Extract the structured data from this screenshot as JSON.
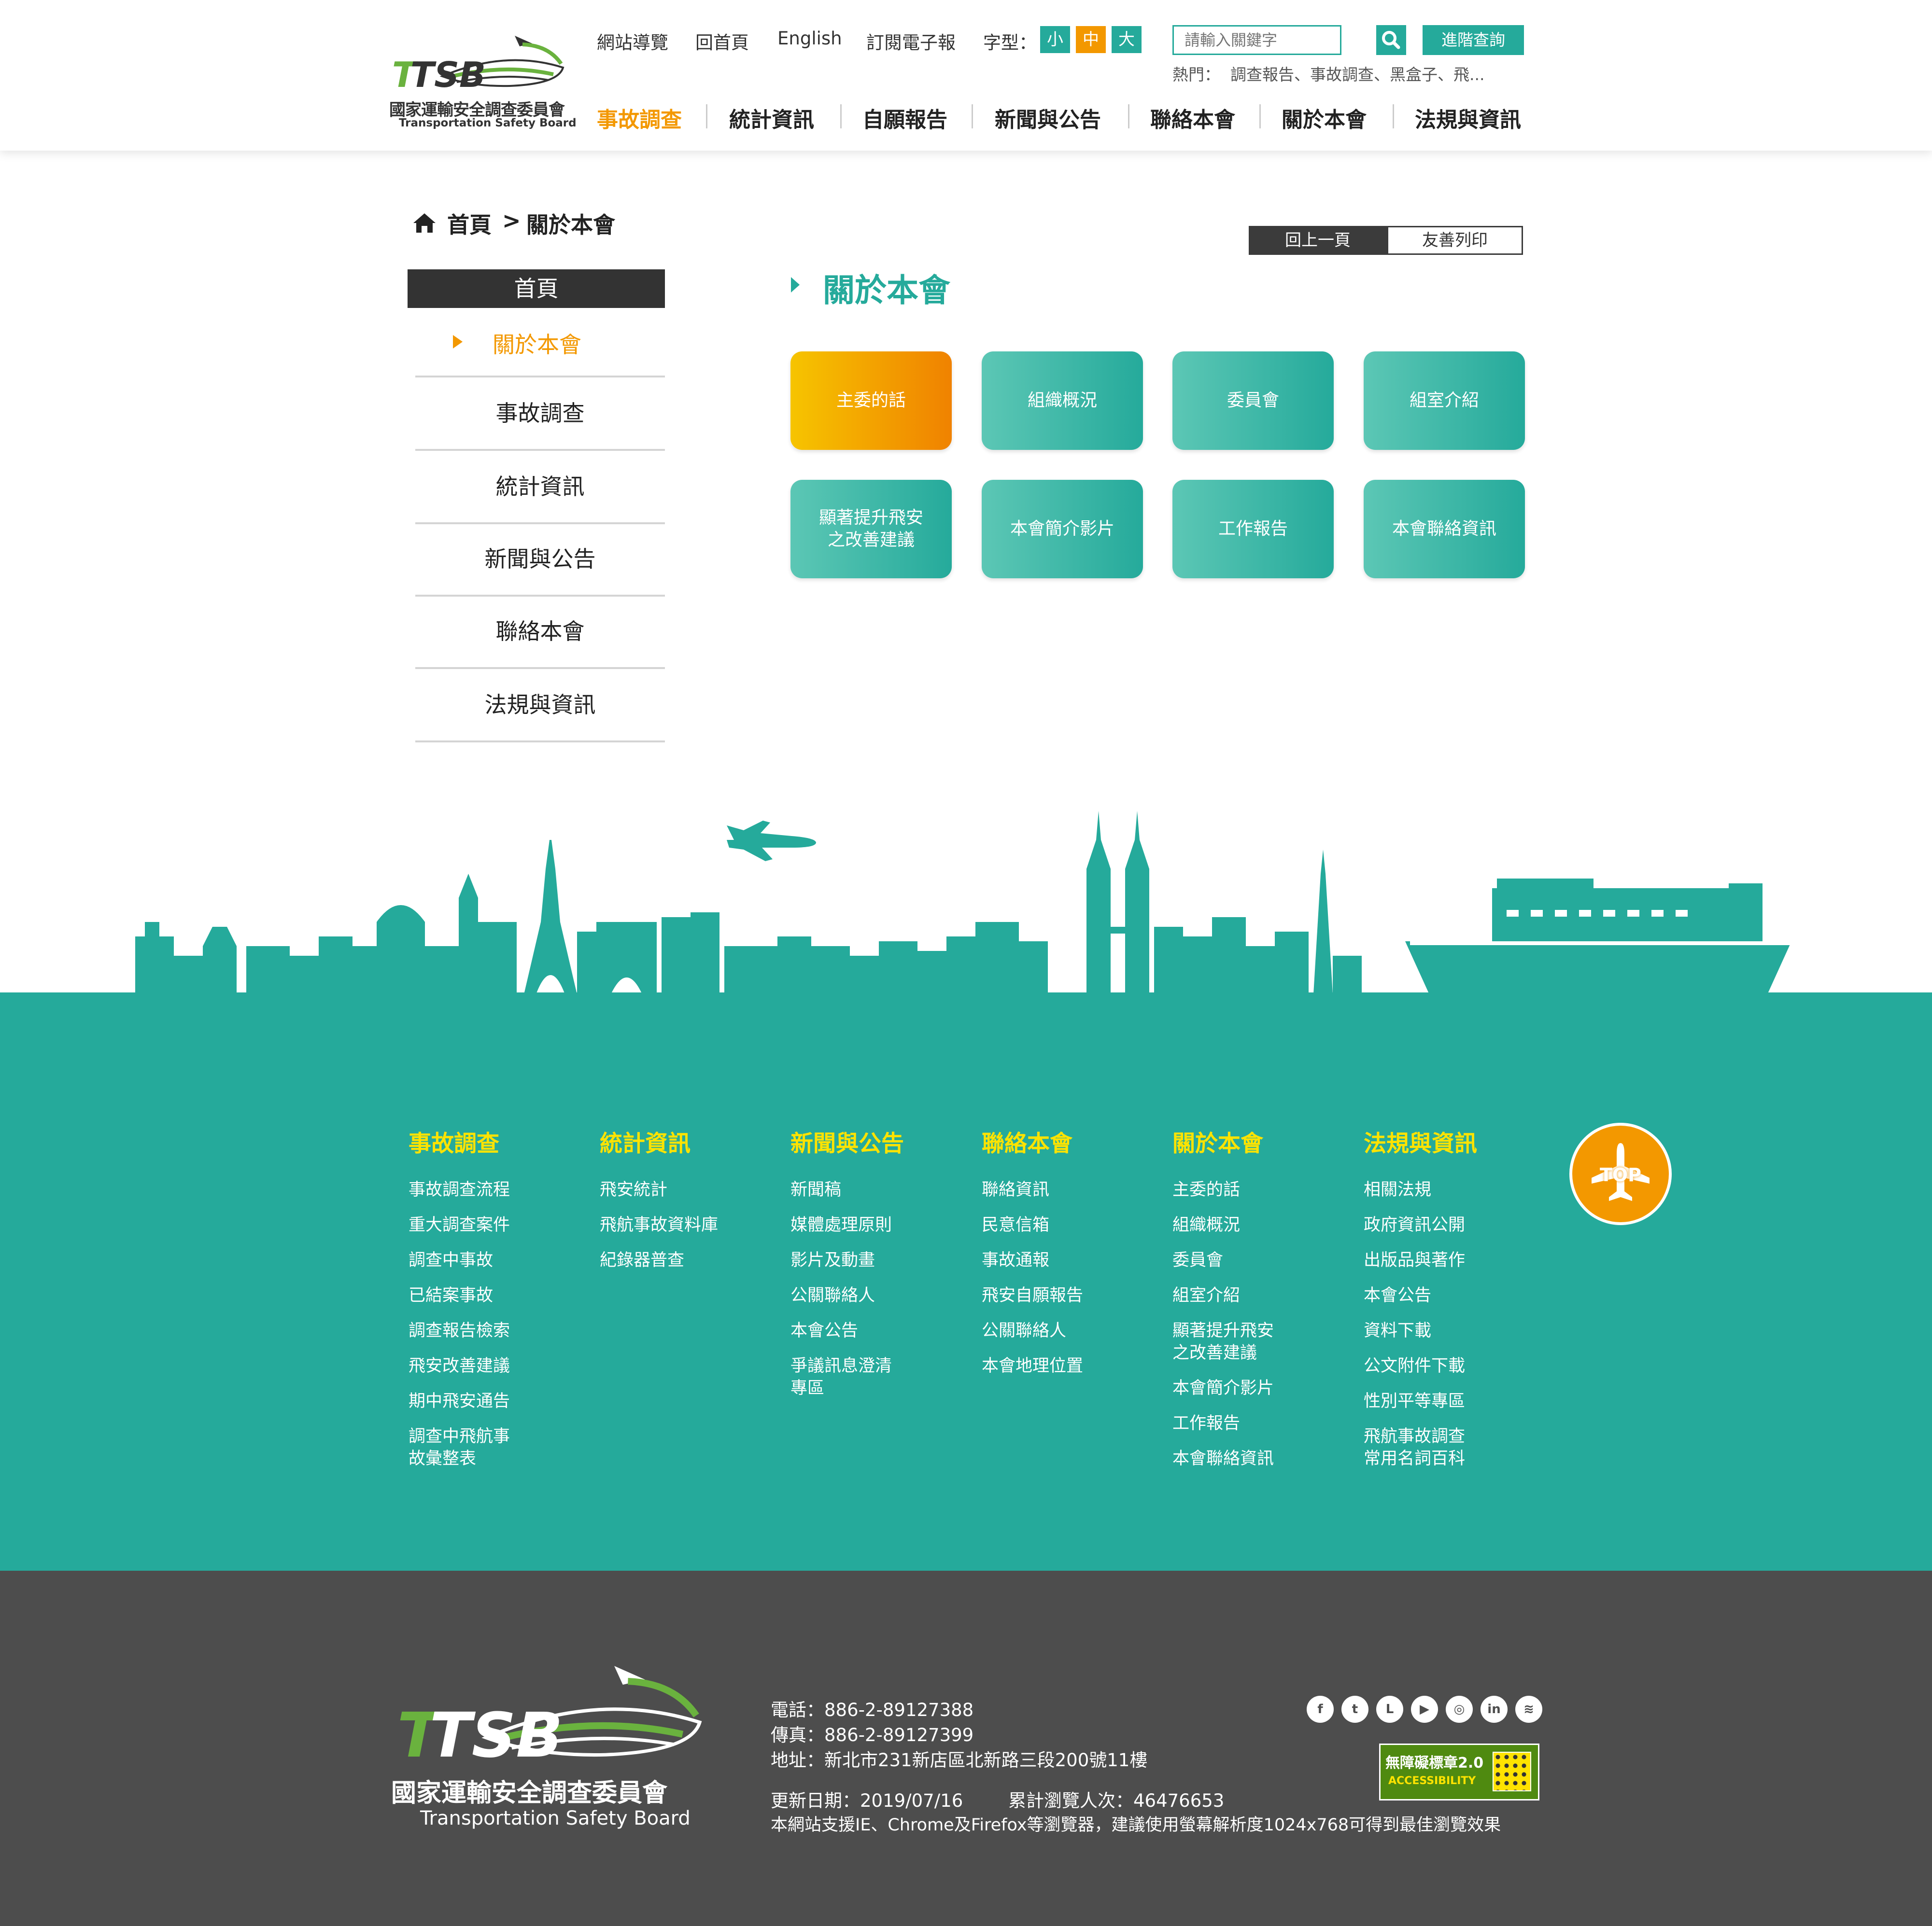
{
  "header": {
    "logo": {
      "mark": "TTSB",
      "name_zh": "國家運輸安全調查委員會",
      "name_en": "Transportation Safety Board"
    },
    "top_links": [
      "網站導覽",
      "回首頁",
      "English",
      "訂閱電子報"
    ],
    "font_size_label": "字型：",
    "font_sizes": [
      {
        "label": "小",
        "color": "#25aa9b"
      },
      {
        "label": "中",
        "color": "#f39800"
      },
      {
        "label": "大",
        "color": "#25aa9b"
      }
    ],
    "search": {
      "placeholder": "請輸入關鍵字",
      "advanced_label": "進階查詢",
      "icon": "search-icon"
    },
    "hot": {
      "label": "熱門：",
      "keywords": "調查報告、事故調查、黑盒子、飛..."
    },
    "nav": [
      "事故調查",
      "統計資訊",
      "自願報告",
      "新聞與公告",
      "聯絡本會",
      "關於本會",
      "法規與資訊"
    ],
    "nav_active": "事故調查"
  },
  "breadcrumb": {
    "home": "首頁",
    "separator": ">",
    "current": "關於本會",
    "icon": "home-icon"
  },
  "page_tools": {
    "back": "回上一頁",
    "print": "友善列印"
  },
  "sidebar": {
    "title": "首頁",
    "active": "關於本會",
    "items": [
      "事故調查",
      "統計資訊",
      "新聞與公告",
      "聯絡本會",
      "法規與資訊"
    ]
  },
  "main": {
    "title": "關於本會",
    "tiles_row1": [
      "主委的話",
      "組織概況",
      "委員會",
      "組室介紹"
    ],
    "tiles_row2": [
      "顯著提升飛安\n之改善建議",
      "本會簡介影片",
      "工作報告",
      "本會聯絡資訊"
    ],
    "active_tile": "主委的話"
  },
  "colors": {
    "accent": "#25aa9b",
    "active": "#f39800",
    "highlight": "#ffe300",
    "dark": "#4d4d4d"
  },
  "footer_columns": [
    {
      "title": "事故調查",
      "links": [
        "事故調查流程",
        "重大調查案件",
        "調查中事故",
        "已結案事故",
        "調查報告檢索",
        "飛安改善建議",
        "期中飛安通告",
        "調查中飛航事\n故彙整表"
      ]
    },
    {
      "title": "統計資訊",
      "links": [
        "飛安統計",
        "飛航事故資料庫",
        "紀錄器普查"
      ]
    },
    {
      "title": "新聞與公告",
      "links": [
        "新聞稿",
        "媒體處理原則",
        "影片及動畫",
        "公關聯絡人",
        "本會公告",
        "爭議訊息澄清\n專區"
      ]
    },
    {
      "title": "聯絡本會",
      "links": [
        "聯絡資訊",
        "民意信箱",
        "事故通報",
        "飛安自願報告",
        "公關聯絡人",
        "本會地理位置"
      ]
    },
    {
      "title": "關於本會",
      "links": [
        "主委的話",
        "組織概況",
        "委員會",
        "組室介紹",
        "顯著提升飛安\n之改善建議",
        "本會簡介影片",
        "工作報告",
        "本會聯絡資訊"
      ]
    },
    {
      "title": "法規與資訊",
      "links": [
        "相關法規",
        "政府資訊公開",
        "出版品與著作",
        "本會公告",
        "資料下載",
        "公文附件下載",
        "性別平等專區",
        "飛航事故調查\n常用名詞百科"
      ]
    }
  ],
  "top_button": {
    "label": "TOP",
    "icon": "airplane-icon"
  },
  "footer_info": {
    "phone": "電話：886-2-89127388",
    "fax": "傳真：886-2-89127399",
    "address": "地址：新北市231新店區北新路三段200號11樓",
    "updated": "更新日期：2019/07/16",
    "visits": "累計瀏覽人次：46476653",
    "browser_note": "本網站支援IE、Chrome及Firefox等瀏覽器，建議使用螢幕解析度1024x768可得到最佳瀏覽效果",
    "accessibility_badge": {
      "title": "無障礙標章2.0",
      "sub": "ACCESSIBILITY"
    },
    "social": [
      {
        "icon": "facebook-icon",
        "glyph": "f"
      },
      {
        "icon": "twitter-icon",
        "glyph": "t"
      },
      {
        "icon": "line-icon",
        "glyph": "L"
      },
      {
        "icon": "youtube-icon",
        "glyph": "▶"
      },
      {
        "icon": "instagram-icon",
        "glyph": "◎"
      },
      {
        "icon": "linkedin-icon",
        "glyph": "in"
      },
      {
        "icon": "rss-icon",
        "glyph": "≋"
      }
    ]
  }
}
